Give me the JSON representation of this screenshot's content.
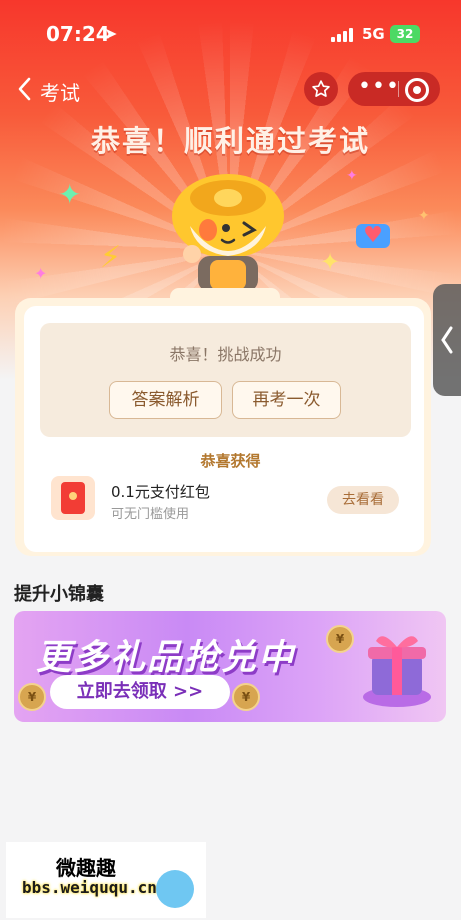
{
  "status_bar": {
    "time": "07:24",
    "network": "5G",
    "battery": "32"
  },
  "nav": {
    "title": "考试",
    "back_icon": "chevron-left-icon",
    "star_icon": "star-icon",
    "more_icon": "more-icon",
    "close_icon": "target-icon"
  },
  "hero": {
    "heading": "恭喜！顺利通过考试"
  },
  "result": {
    "title": "恭喜！挑战成功",
    "buttons": [
      {
        "label": "答案解析"
      },
      {
        "label": "再考一次"
      }
    ]
  },
  "reward": {
    "section_label": "恭喜获得",
    "name": "0.1元支付红包",
    "desc": "可无门槛使用",
    "action": "去看看"
  },
  "side_handle": {
    "icon": "chevron-left-icon"
  },
  "tips": {
    "title": "提升小锦囊",
    "banner_title": "更多礼品抢兑中",
    "banner_button": "立即去领取 >>"
  },
  "watermark": {
    "title": "微趣趣",
    "url": "bbs.weiququ.cn"
  },
  "colors": {
    "primary": "#f7372c",
    "accent_gold": "#b3782f",
    "banner_purple": "#c98af5"
  }
}
